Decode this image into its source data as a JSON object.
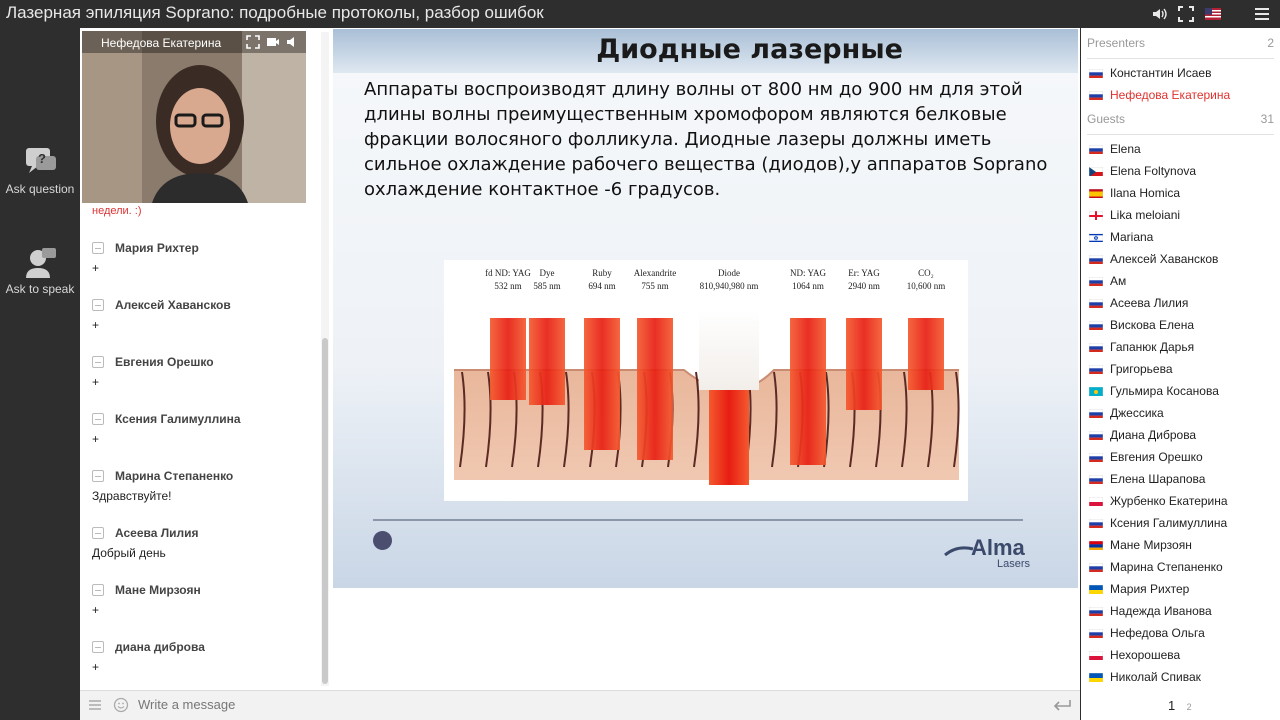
{
  "window": {
    "title": "Лазерная эпиляция Soprano: подробные протоколы, разбор ошибок",
    "icons": [
      "volume-icon",
      "fullscreen-icon",
      "us-flag-icon",
      "menu-icon"
    ]
  },
  "rail": {
    "ask_question": "Ask question",
    "ask_to_speak": "Ask to speak"
  },
  "video": {
    "name": "Нефедова Екатерина"
  },
  "chat": {
    "cut_text": "недели. :)",
    "messages": [
      {
        "author": "Мария Рихтер",
        "text": "+"
      },
      {
        "author": "Алексей Хавансков",
        "text": "+"
      },
      {
        "author": "Евгения Орешко",
        "text": "+"
      },
      {
        "author": "Ксения Галимуллина",
        "text": "+"
      },
      {
        "author": "Марина Степаненко",
        "text": "Здравствуйте!"
      },
      {
        "author": "Асеева Лилия",
        "text": "Добрый день"
      },
      {
        "author": "Мане Мирзоян",
        "text": "+"
      },
      {
        "author": "диана диброва",
        "text": "+"
      }
    ],
    "placeholder": "Write a message"
  },
  "slide": {
    "title": "Диодные лазерные",
    "body": "Аппараты воспроизводят длину волны от 800 нм до 900 нм для этой длины волны преимущественным  хромофором являются белковые фракции волосяного фолликула. Диодные лазеры должны иметь сильное охлаждение рабочего вещества (диодов),у аппаратов Soprano охлаждение контактное -6 градусов.",
    "figure_lasers": [
      {
        "name": "fd ND: YAG",
        "wl": "532 nm"
      },
      {
        "name": "Dye",
        "wl": "585 nm"
      },
      {
        "name": "Ruby",
        "wl": "694 nm"
      },
      {
        "name": "Alexandrite",
        "wl": "755 nm"
      },
      {
        "name": "Diode",
        "wl": "810,940,980  nm"
      },
      {
        "name": "ND: YAG",
        "wl": "1064 nm"
      },
      {
        "name": "Er: YAG",
        "wl": "2940 nm"
      },
      {
        "name": "CO₂",
        "wl": "10,600 nm"
      }
    ],
    "logo_name": "Alma",
    "logo_sub": "Lasers"
  },
  "presenters": {
    "label": "Presenters",
    "count": "2",
    "items": [
      {
        "name": "Константин Исаев",
        "flag": "ru",
        "active": false
      },
      {
        "name": "Нефедова Екатерина",
        "flag": "ru",
        "active": true
      }
    ]
  },
  "guests": {
    "label": "Guests",
    "count": "31",
    "items": [
      {
        "name": "Elena",
        "flag": "ru"
      },
      {
        "name": "Elena Foltynova",
        "flag": "cz"
      },
      {
        "name": "Ilana Homica",
        "flag": "es"
      },
      {
        "name": "Lika meloiani",
        "flag": "ge"
      },
      {
        "name": "Mariana",
        "flag": "il"
      },
      {
        "name": "Алексей Хавансков",
        "flag": "ru"
      },
      {
        "name": "Ам",
        "flag": "ru"
      },
      {
        "name": "Асеева Лилия",
        "flag": "ru"
      },
      {
        "name": "Вискова Елена",
        "flag": "ru"
      },
      {
        "name": "Гапанюк Дарья",
        "flag": "ru"
      },
      {
        "name": "Григорьева",
        "flag": "ru"
      },
      {
        "name": "Гульмира Косанова",
        "flag": "kz"
      },
      {
        "name": "Джессика",
        "flag": "ru"
      },
      {
        "name": "Диана Диброва",
        "flag": "ru"
      },
      {
        "name": "Евгения Орешко",
        "flag": "ru"
      },
      {
        "name": "Елена Шарапова",
        "flag": "ru"
      },
      {
        "name": "Журбенко Екатерина",
        "flag": "pl"
      },
      {
        "name": "Ксения Галимуллина",
        "flag": "ru"
      },
      {
        "name": "Мане Мирзоян",
        "flag": "am"
      },
      {
        "name": "Марина Степаненко",
        "flag": "ru"
      },
      {
        "name": "Мария Рихтер",
        "flag": "ua"
      },
      {
        "name": "Надежда Иванова",
        "flag": "ru"
      },
      {
        "name": "Нефедова Ольга",
        "flag": "ru"
      },
      {
        "name": "Нехорошева",
        "flag": "pl"
      },
      {
        "name": "Николай Спивак",
        "flag": "ua"
      }
    ],
    "pages": [
      "1",
      "2"
    ],
    "current_page": "1"
  },
  "colors": {
    "active_presenter": "#e0332f",
    "accent": "#2e2e2e"
  }
}
